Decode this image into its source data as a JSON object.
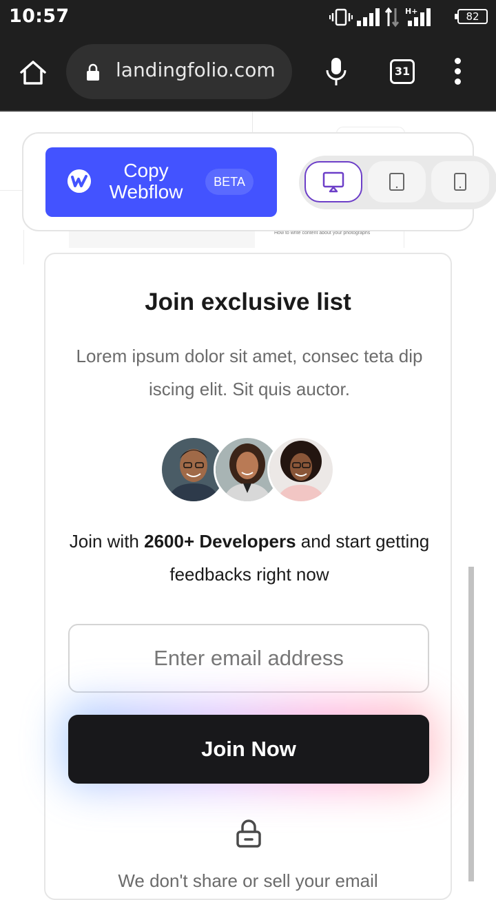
{
  "status_bar": {
    "time": "10:57",
    "battery_level": "82",
    "icons": [
      "vibrate-icon",
      "signal-icon",
      "data-arrows-icon",
      "hplus-signal-icon",
      "battery-icon"
    ]
  },
  "browser": {
    "url": "landingfolio.com",
    "tab_count": "31",
    "icons": [
      "home-icon",
      "lock-icon",
      "mic-icon",
      "tabs-icon",
      "more-vert-icon"
    ]
  },
  "background": {
    "snippet_text": "How to write content about your photographs"
  },
  "toolbar": {
    "copy_label": "Copy Webflow",
    "badge": "BETA",
    "accent_color": "#4353ff",
    "devices": [
      {
        "name": "desktop",
        "active": true
      },
      {
        "name": "tablet",
        "active": false
      },
      {
        "name": "mobile",
        "active": false
      }
    ]
  },
  "card": {
    "title": "Join exclusive list",
    "description": "Lorem ipsum dolor sit amet, consec teta dip iscing elit. Sit quis auctor.",
    "join_prefix": "Join with ",
    "join_highlight": "2600+ Developers",
    "join_suffix": " and start getting feedbacks right now",
    "email_placeholder": "Enter email address",
    "button_label": "Join Now",
    "privacy": "We don't share or sell your email"
  }
}
